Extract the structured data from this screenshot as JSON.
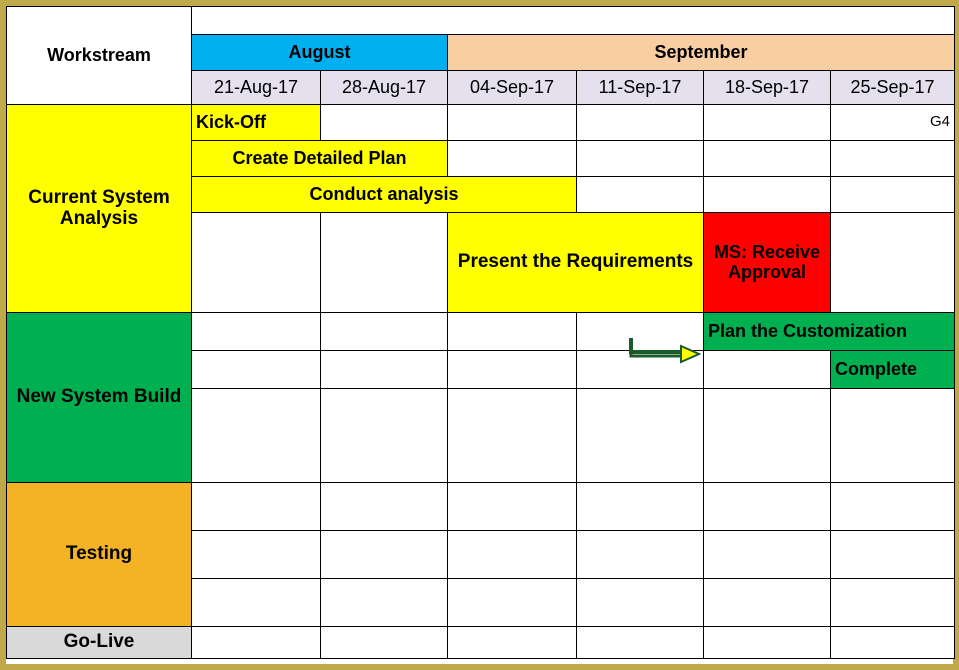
{
  "header": {
    "workstream_label": "Workstream",
    "months": {
      "august": "August",
      "september": "September"
    },
    "dates": [
      "21-Aug-17",
      "28-Aug-17",
      "04-Sep-17",
      "11-Sep-17",
      "18-Sep-17",
      "25-Sep-17"
    ]
  },
  "streams": {
    "current_analysis": {
      "label": "Current System Analysis",
      "tasks": {
        "kick_off": "Kick-Off",
        "create_plan": "Create Detailed Plan",
        "conduct_analysis": "Conduct analysis",
        "present_req": "Present the Requirements",
        "ms_receive_approval": "MS: Receive Approval",
        "g4": "G4"
      }
    },
    "new_build": {
      "label": "New System Build",
      "tasks": {
        "plan_cust": "Plan the Customization",
        "complete": "Complete "
      }
    },
    "testing": {
      "label": "Testing"
    },
    "go_live": {
      "label": "Go-Live"
    }
  },
  "colors": {
    "arrow_stroke": "#1b5a2b",
    "arrow_fill": "#ffff00"
  }
}
